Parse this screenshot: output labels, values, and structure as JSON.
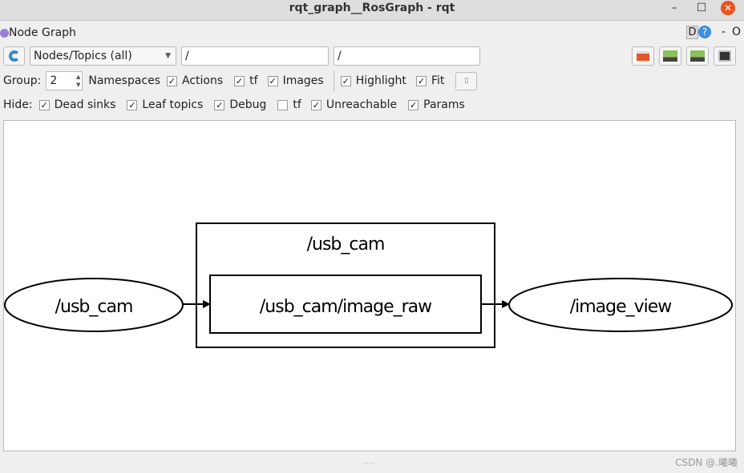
{
  "window": {
    "title": "rqt_graph__RosGraph - rqt",
    "minimize": "–",
    "maximize": "☐",
    "close": "✕"
  },
  "plugin": {
    "title": "Node Graph",
    "d_label": "D",
    "help_label": "?",
    "dash_label": "-",
    "o_label": "O"
  },
  "toolbar": {
    "mode_select": "Nodes/Topics (all)",
    "node_filter": "/",
    "topic_filter": "/"
  },
  "options": {
    "group_label": "Group:",
    "group_value": "2",
    "namespaces_label": "Namespaces",
    "checks": [
      {
        "label": "Actions",
        "checked": true
      },
      {
        "label": "tf",
        "checked": true
      },
      {
        "label": "Images",
        "checked": true
      },
      {
        "label": "Highlight",
        "checked": true
      },
      {
        "label": "Fit",
        "checked": true
      }
    ]
  },
  "hide": {
    "label": "Hide:",
    "checks": [
      {
        "label": "Dead sinks",
        "checked": true
      },
      {
        "label": "Leaf topics",
        "checked": true
      },
      {
        "label": "Debug",
        "checked": true
      },
      {
        "label": "tf",
        "checked": false
      },
      {
        "label": "Unreachable",
        "checked": true
      },
      {
        "label": "Params",
        "checked": true
      }
    ]
  },
  "graph": {
    "cluster_label": "/usb_cam",
    "topic": "/usb_cam/image_raw",
    "source_node": "/usb_cam",
    "sink_node": "/image_view"
  },
  "watermark": "CSDN @.曦曦"
}
